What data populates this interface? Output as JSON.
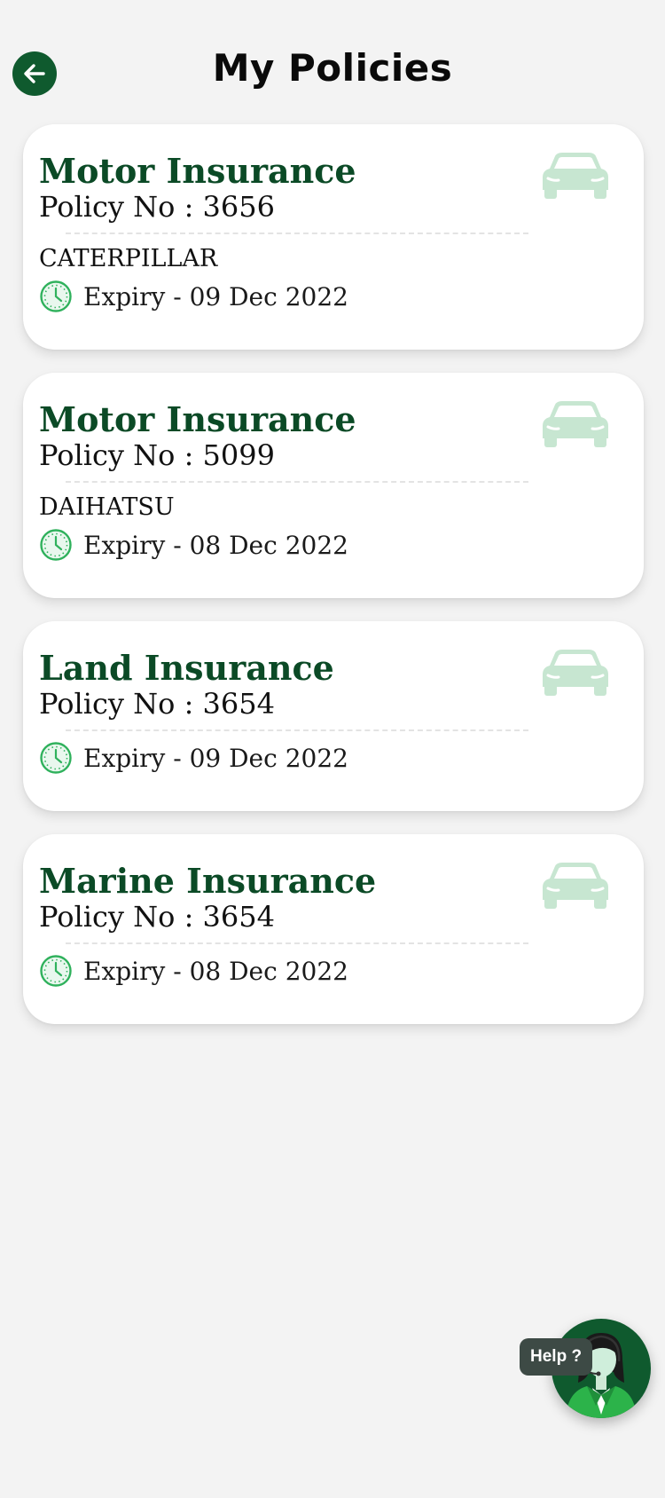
{
  "header": {
    "title": "My Policies",
    "back_icon": "arrow-left-icon"
  },
  "policies": [
    {
      "title": "Motor Insurance",
      "policy_no": "Policy No : 3656",
      "vehicle": "CATERPILLAR",
      "expiry": "Expiry - 09 Dec 2022",
      "icon": "car-icon"
    },
    {
      "title": "Motor Insurance",
      "policy_no": "Policy No : 5099",
      "vehicle": "DAIHATSU",
      "expiry": "Expiry - 08 Dec 2022",
      "icon": "car-icon"
    },
    {
      "title": "Land Insurance",
      "policy_no": "Policy No : 3654",
      "expiry": "Expiry - 09 Dec 2022",
      "icon": "car-icon"
    },
    {
      "title": "Marine Insurance",
      "policy_no": "Policy No : 3654",
      "expiry": "Expiry - 08 Dec 2022",
      "icon": "car-icon"
    }
  ],
  "help": {
    "label": "Help ?",
    "icon": "support-agent-icon"
  },
  "colors": {
    "brand_green": "#0f5a2e",
    "title_green": "#0b4a26",
    "icon_light_green": "#c7e6d1",
    "clock_green": "#2fb15c",
    "background": "#f3f3f3"
  }
}
